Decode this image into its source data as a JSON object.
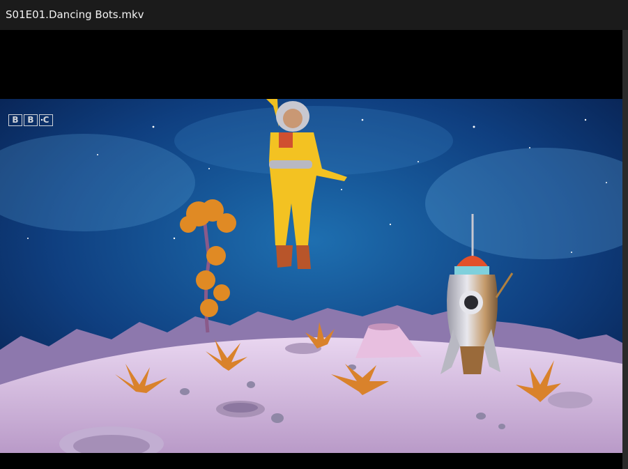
{
  "window": {
    "title": "S01E01.Dancing Bots.mkv"
  },
  "video": {
    "logo_letters": [
      "B",
      "B",
      "C"
    ],
    "scene": "space-moon-rocket"
  }
}
